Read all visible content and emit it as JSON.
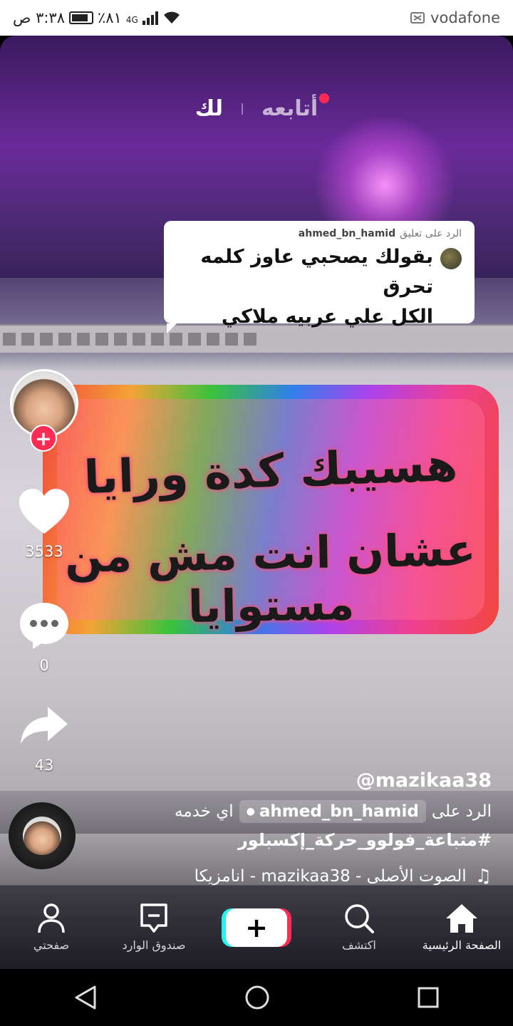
{
  "status_bar": {
    "carrier": "vodafone",
    "time": "٣:٣٨ ص",
    "battery": "٪٨١",
    "network": "4G"
  },
  "top_tabs": {
    "following": "أتابعه",
    "for_you": "لك"
  },
  "reply_bubble": {
    "header_prefix": "الرد على تعليق",
    "username": "ahmed_bn_hamid",
    "text_line1": "بقولك يصحبي عاوز كلمه تحرق",
    "text_line2": "الكل علي عربيه ملاكي"
  },
  "video_sticker": {
    "line1": "هسيبك كدة ورايا",
    "line2": "عشان انت مش من مستوايا"
  },
  "rail": {
    "likes": "3533",
    "comments": "0",
    "shares": "43",
    "follow_plus": "+"
  },
  "caption": {
    "username": "@mazikaa38",
    "reply_prefix": "الرد على",
    "reply_user": "ahmed_bn_hamid",
    "reply_suffix": "اي خدمه",
    "hashtags": "#متباعة_فولوو_حركة_إكسبلور",
    "sound": "الصوت الأصلى - mazikaa38 - انامزيكا"
  },
  "bottom_nav": {
    "home": "الصفحة الرئيسية",
    "discover": "اكتشف",
    "create": "+",
    "inbox": "صندوق الوارد",
    "profile": "صفحتي"
  },
  "colors": {
    "accent_red": "#fe2c55",
    "accent_cyan": "#25f4ee"
  },
  "icons": [
    "heart-icon",
    "comment-icon",
    "share-icon",
    "music-note-icon",
    "home-icon",
    "search-icon",
    "inbox-icon",
    "profile-icon",
    "back-icon",
    "home-circle-icon",
    "recents-icon"
  ]
}
